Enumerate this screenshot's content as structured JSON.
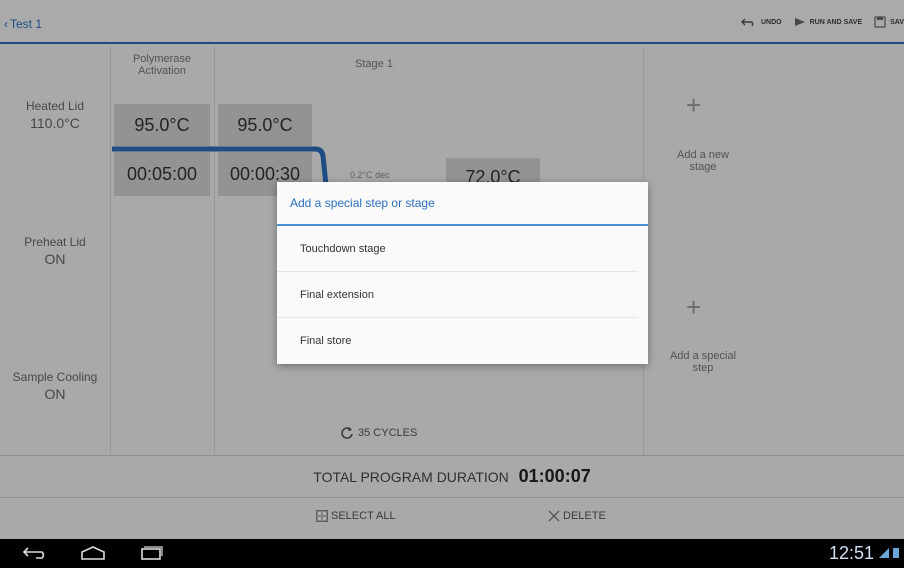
{
  "topbar": {
    "back_label": "Test 1",
    "undo_label": "UNDO",
    "run_save_label": "RUN AND SAVE",
    "save_label": "SAV"
  },
  "columns": {
    "col1_header": "Polymerase\nActivation",
    "col2_header": "Stage 1"
  },
  "side": {
    "heated_lid_label": "Heated Lid",
    "heated_lid_value": "110.0°C",
    "preheat_lid_label": "Preheat Lid",
    "preheat_lid_value": "ON",
    "sample_cooling_label": "Sample Cooling",
    "sample_cooling_value": "ON"
  },
  "steps": {
    "step1_temp": "95.0°C",
    "step1_time": "00:05:00",
    "step2_temp": "95.0°C",
    "step2_time": "00:00:30",
    "step3_rate": "0.2°C dec",
    "step3_temp": "72.0°C"
  },
  "add": {
    "new_stage_label": "Add a new\nstage",
    "special_step_label": "Add a special\nstep"
  },
  "cycles_label": "35 CYCLES",
  "total": {
    "label": "TOTAL PROGRAM DURATION",
    "duration": "01:00:07"
  },
  "bottom": {
    "select_all_label": "SELECT ALL",
    "delete_label": "DELETE"
  },
  "dialog": {
    "title": "Add a special step or stage",
    "items": [
      "Touchdown stage",
      "Final extension",
      "Final store"
    ]
  },
  "statusbar": {
    "clock": "12:51"
  },
  "colors": {
    "accent": "#2c6fc0",
    "tile": "#d3d3d3"
  }
}
